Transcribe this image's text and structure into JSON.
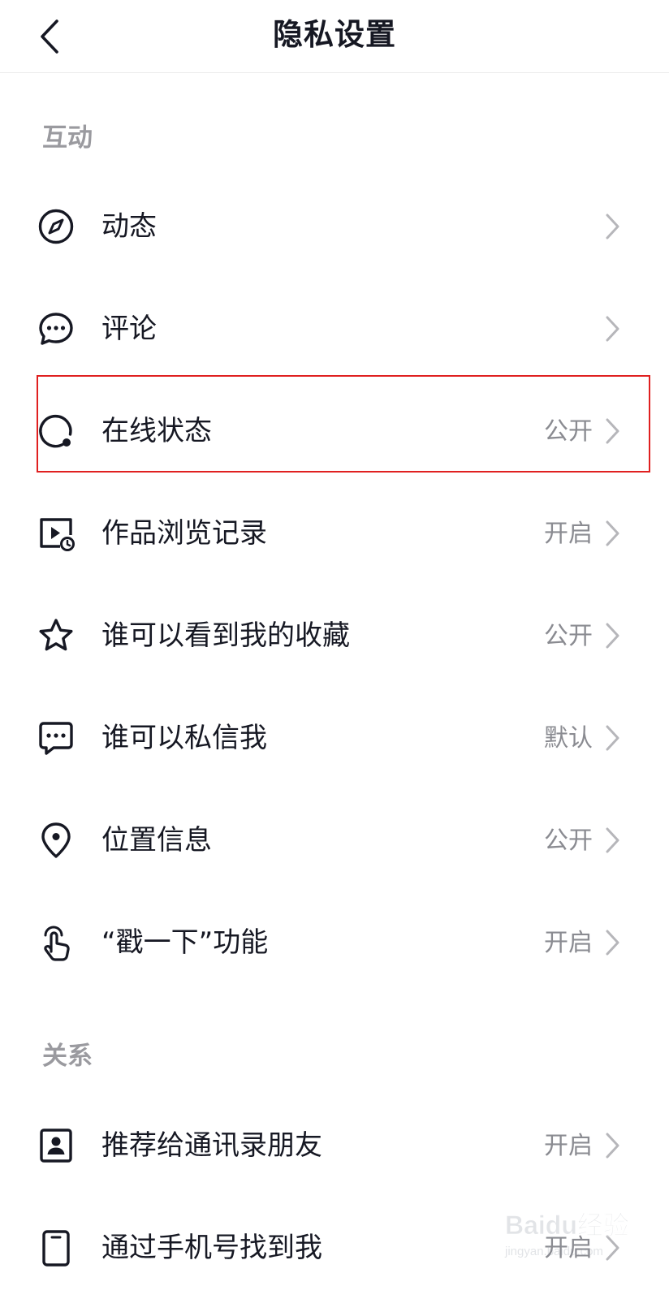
{
  "header": {
    "title": "隐私设置",
    "back_icon": "chevron-left-icon"
  },
  "sections": [
    {
      "title": "互动",
      "items": [
        {
          "label": "动态",
          "value": "",
          "icon": "compass-icon"
        },
        {
          "label": "评论",
          "value": "",
          "icon": "comment-bubble-icon"
        },
        {
          "label": "在线状态",
          "value": "公开",
          "icon": "online-status-icon",
          "highlighted": true
        },
        {
          "label": "作品浏览记录",
          "value": "开启",
          "icon": "video-history-icon"
        },
        {
          "label": "谁可以看到我的收藏",
          "value": "公开",
          "icon": "star-icon"
        },
        {
          "label": "谁可以私信我",
          "value": "默认",
          "icon": "message-square-icon"
        },
        {
          "label": "位置信息",
          "value": "公开",
          "icon": "location-pin-icon"
        },
        {
          "label": "“戳一下”功能",
          "value": "开启",
          "icon": "finger-tap-icon"
        }
      ]
    },
    {
      "title": "关系",
      "items": [
        {
          "label": "推荐给通讯录朋友",
          "value": "开启",
          "icon": "contact-card-icon"
        },
        {
          "label": "通过手机号找到我",
          "value": "开启",
          "icon": "phone-icon"
        }
      ]
    }
  ],
  "colors": {
    "text": "#161823",
    "section": "#9a9a9f",
    "value": "#8a8b91",
    "highlight": "#e02020"
  },
  "watermark": {
    "text": "Baidu经验",
    "subtext": "jingyan.baidu.com"
  }
}
